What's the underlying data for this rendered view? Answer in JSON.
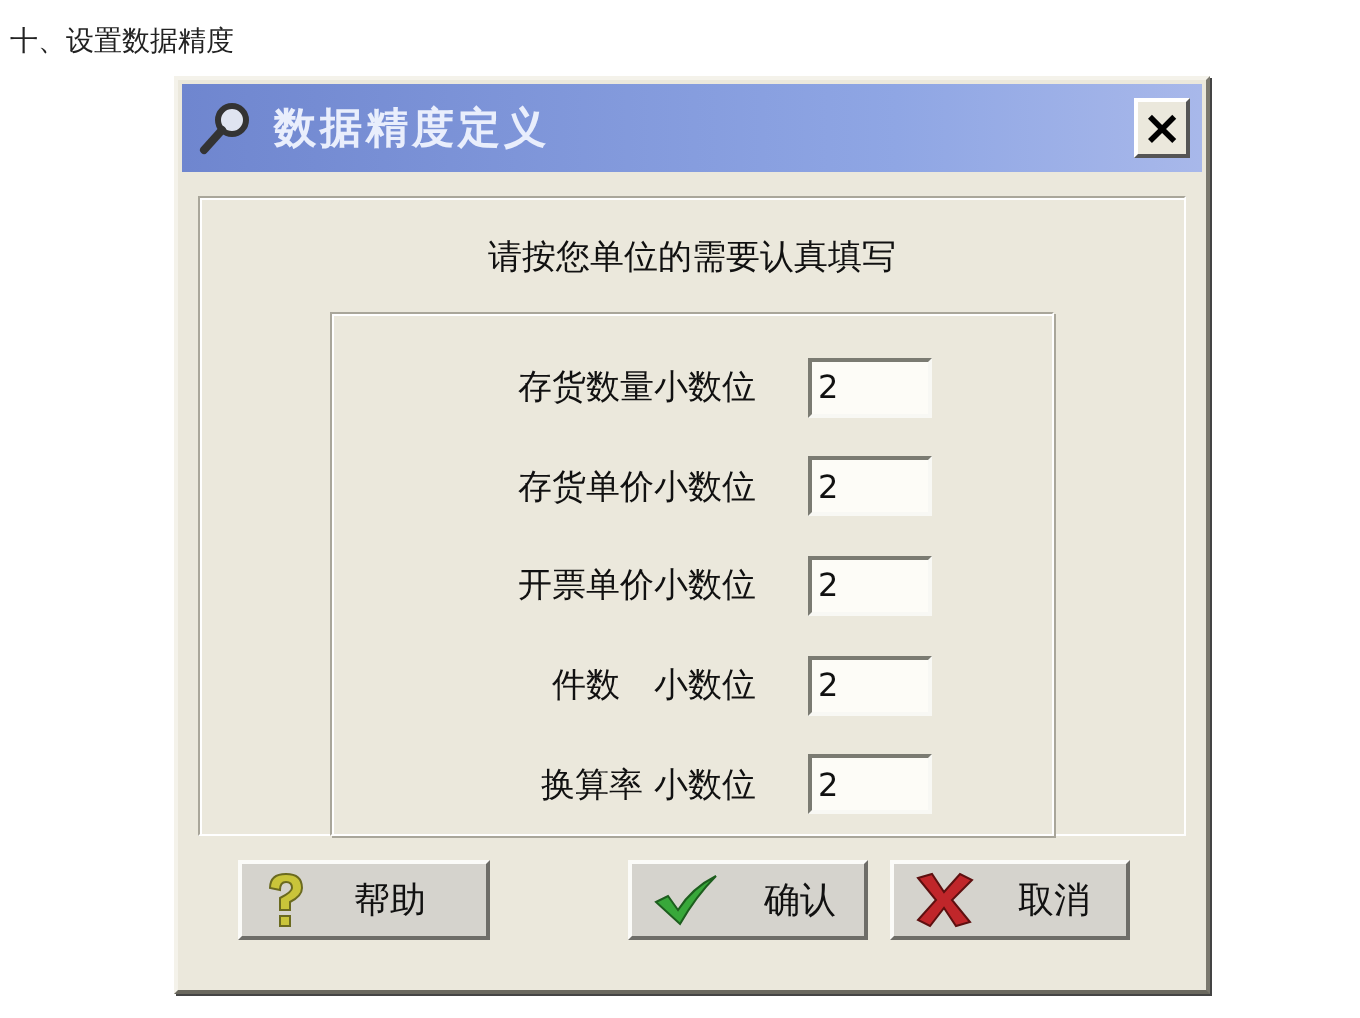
{
  "heading": "十、设置数据精度",
  "window": {
    "title": "数据精度定义",
    "close": "×"
  },
  "instruction": "请按您单位的需要认真填写",
  "fields": [
    {
      "label": "存货数量小数位",
      "value": "2"
    },
    {
      "label": "存货单价小数位",
      "value": "2"
    },
    {
      "label": "开票单价小数位",
      "value": "2"
    },
    {
      "label": "件数　小数位",
      "value": "2"
    },
    {
      "label": "换算率 小数位",
      "value": "2"
    }
  ],
  "buttons": [
    {
      "kind": "help",
      "label": "帮助"
    },
    {
      "kind": "ok",
      "label": "确认"
    },
    {
      "kind": "cancel",
      "label": "取消"
    }
  ]
}
